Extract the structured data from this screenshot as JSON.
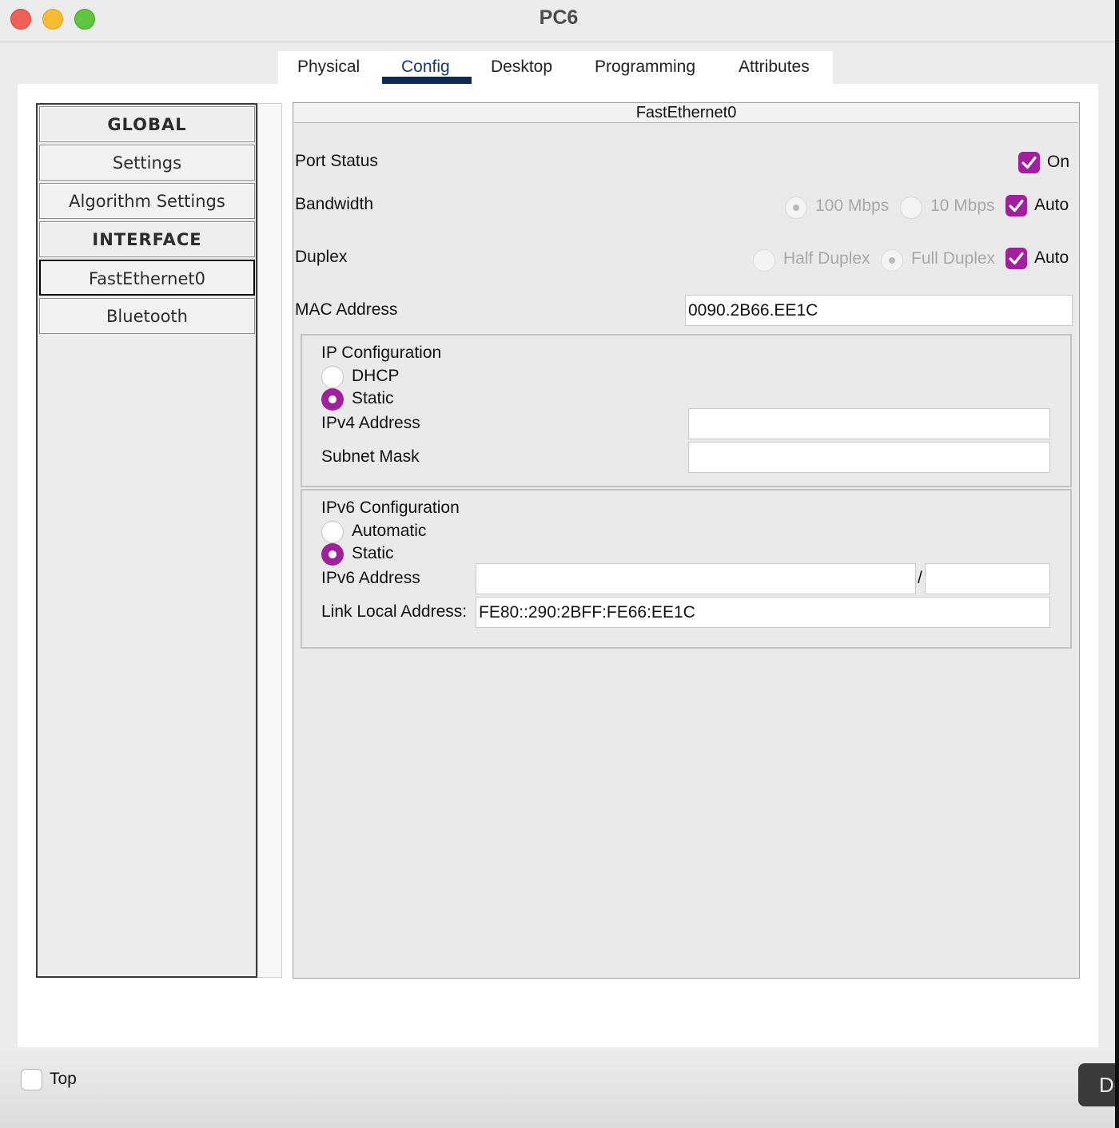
{
  "window": {
    "title": "PC6",
    "controls": [
      "close",
      "minimize",
      "zoom"
    ],
    "colors": {
      "close": "#ee5f57",
      "minimize": "#f5bd2f",
      "zoom": "#5fc43f",
      "accent": "#a1209e",
      "active_tab": "#0d2a52"
    }
  },
  "tabs": [
    {
      "label": "Physical",
      "active": false
    },
    {
      "label": "Config",
      "active": true
    },
    {
      "label": "Desktop",
      "active": false
    },
    {
      "label": "Programming",
      "active": false
    },
    {
      "label": "Attributes",
      "active": false
    }
  ],
  "sidebar": {
    "items": [
      {
        "label": "GLOBAL",
        "type": "header"
      },
      {
        "label": "Settings",
        "type": "item"
      },
      {
        "label": "Algorithm Settings",
        "type": "item"
      },
      {
        "label": "INTERFACE",
        "type": "header"
      },
      {
        "label": "FastEthernet0",
        "type": "item",
        "selected": true
      },
      {
        "label": "Bluetooth",
        "type": "item"
      }
    ]
  },
  "interface": {
    "title": "FastEthernet0",
    "port_status": {
      "label": "Port Status",
      "checkbox_label": "On",
      "checked": true
    },
    "bandwidth": {
      "label": "Bandwidth",
      "option_100": "100 Mbps",
      "option_10": "10 Mbps",
      "selected": "100 Mbps",
      "auto_label": "Auto",
      "auto_checked": true
    },
    "duplex": {
      "label": "Duplex",
      "option_half": "Half Duplex",
      "option_full": "Full Duplex",
      "selected": "Full Duplex",
      "auto_label": "Auto",
      "auto_checked": true
    },
    "mac": {
      "label": "MAC Address",
      "value": "0090.2B66.EE1C"
    },
    "ip_config": {
      "title": "IP Configuration",
      "dhcp_label": "DHCP",
      "static_label": "Static",
      "selected": "Static",
      "ipv4_label": "IPv4 Address",
      "ipv4_value": "",
      "subnet_label": "Subnet Mask",
      "subnet_value": ""
    },
    "ipv6_config": {
      "title": "IPv6 Configuration",
      "automatic_label": "Automatic",
      "static_label": "Static",
      "selected": "Static",
      "ipv6_label": "IPv6 Address",
      "ipv6_value": "",
      "separator": "/",
      "prefix_value": "",
      "link_local_label": "Link Local Address:",
      "link_local_value": "FE80::290:2BFF:FE66:EE1C"
    }
  },
  "footer": {
    "top_label": "Top",
    "top_checked": false,
    "dock_button_label": "De"
  }
}
